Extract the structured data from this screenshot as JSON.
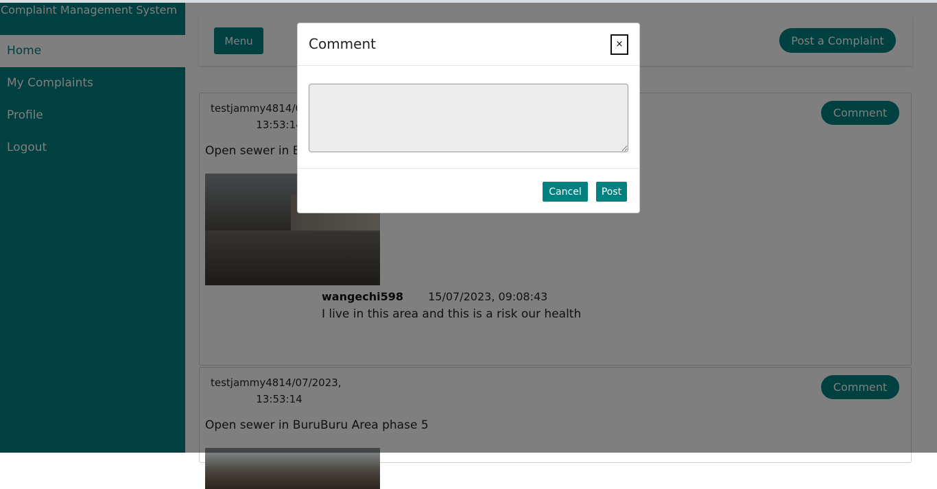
{
  "app": {
    "title": "Complaint Management System"
  },
  "sidebar": {
    "items": [
      {
        "label": "Home",
        "active": true
      },
      {
        "label": "My Complaints",
        "active": false
      },
      {
        "label": "Profile",
        "active": false
      },
      {
        "label": "Logout",
        "active": false
      }
    ]
  },
  "topbar": {
    "menu_label": "Menu",
    "post_complaint_label": "Post a Complaint"
  },
  "complaints": [
    {
      "user_date": "testjammy4814/07/2023,",
      "time": "13:53:14",
      "description": "Open sewer in BuruBuru Area phase 5",
      "comment_button": "Comment",
      "comments": [
        {
          "user": "wangechi598",
          "date": "15/07/2023, 09:08:43",
          "text": "I live in this area and this is a risk our health"
        }
      ]
    },
    {
      "user_date": "testjammy4814/07/2023,",
      "time": "13:53:14",
      "description": "Open sewer in BuruBuru Area phase 5",
      "comment_button": "Comment",
      "comments": []
    }
  ],
  "modal": {
    "title": "Comment",
    "close_label": "×",
    "textarea_value": "",
    "cancel_label": "Cancel",
    "post_label": "Post"
  },
  "colors": {
    "primary": "#008080",
    "overlay": "rgba(0,0,0,0.5)"
  }
}
